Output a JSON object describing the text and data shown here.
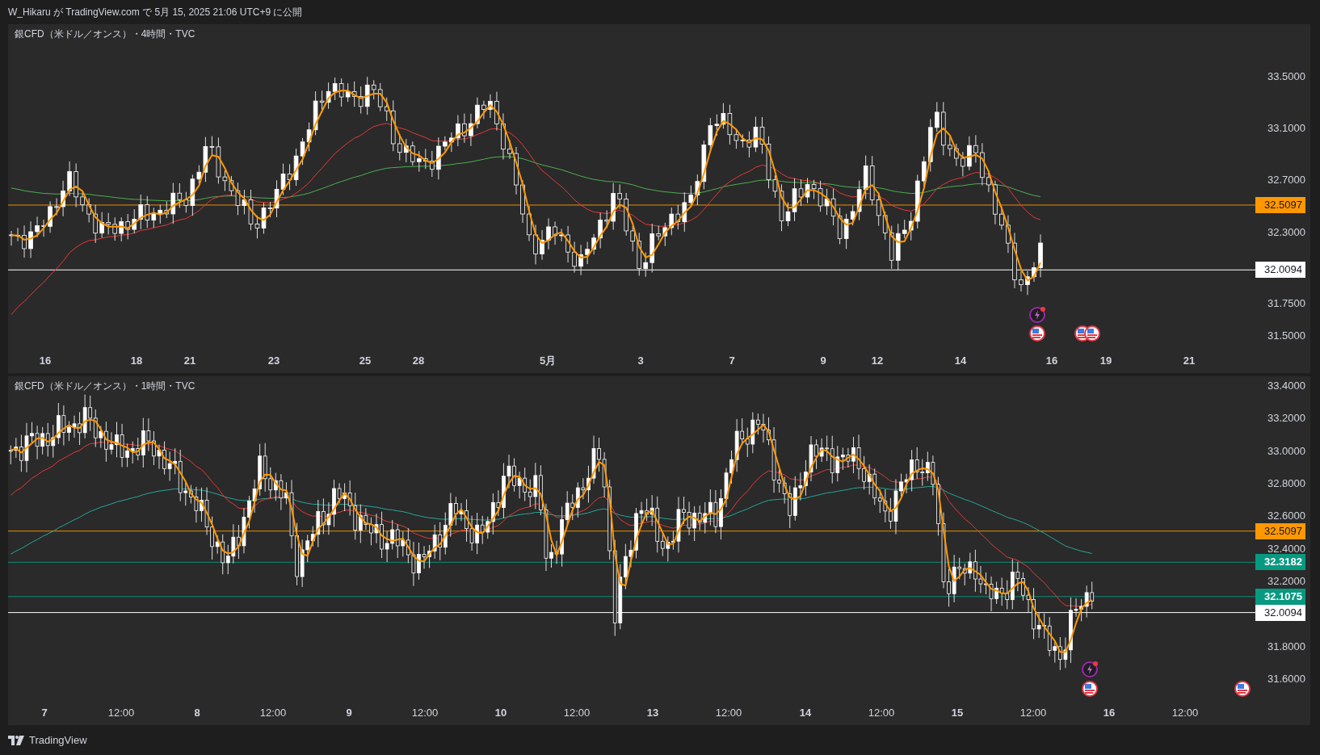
{
  "header": {
    "text": "W_Hikaru が TradingView.com で 5月 15, 2025 21:06 UTC+9 に公開"
  },
  "panels": [
    {
      "title": "銀CFD（米ドル／オンス）・4時間・TVC",
      "price_axis": [
        "33.5000",
        "33.1000",
        "32.7000",
        "32.3000",
        "31.7500",
        "31.5000"
      ],
      "levels": [
        {
          "value": "32.5097",
          "color": "#ff9800"
        },
        {
          "value": "32.0094",
          "color": "#ffffff"
        }
      ],
      "time_axis": [
        {
          "text": "16",
          "kind": "day"
        },
        {
          "text": "18",
          "kind": "day"
        },
        {
          "text": "21",
          "kind": "day"
        },
        {
          "text": "23",
          "kind": "day"
        },
        {
          "text": "25",
          "kind": "day"
        },
        {
          "text": "28",
          "kind": "day"
        },
        {
          "text": "5月",
          "kind": "month"
        },
        {
          "text": "3",
          "kind": "day"
        },
        {
          "text": "7",
          "kind": "day"
        },
        {
          "text": "9",
          "kind": "day"
        },
        {
          "text": "12",
          "kind": "day"
        },
        {
          "text": "14",
          "kind": "day"
        },
        {
          "text": "16",
          "kind": "day"
        },
        {
          "text": "19",
          "kind": "day"
        },
        {
          "text": "21",
          "kind": "day"
        }
      ]
    },
    {
      "title": "銀CFD（米ドル／オンス）・1時間・TVC",
      "price_axis": [
        "33.4000",
        "33.2000",
        "33.0000",
        "32.8000",
        "32.6000",
        "32.4000",
        "32.2000",
        "31.8000",
        "31.6000"
      ],
      "levels": [
        {
          "value": "32.5097",
          "color": "#ff9800"
        },
        {
          "value": "32.3182",
          "color": "#089981"
        },
        {
          "value": "32.1075",
          "color": "#089981"
        },
        {
          "value": "32.0094",
          "color": "#ffffff"
        }
      ],
      "time_axis": [
        {
          "text": "7",
          "kind": "day"
        },
        {
          "text": "12:00",
          "kind": "time"
        },
        {
          "text": "8",
          "kind": "day"
        },
        {
          "text": "12:00",
          "kind": "time"
        },
        {
          "text": "9",
          "kind": "day"
        },
        {
          "text": "12:00",
          "kind": "time"
        },
        {
          "text": "10",
          "kind": "day"
        },
        {
          "text": "12:00",
          "kind": "time"
        },
        {
          "text": "13",
          "kind": "day"
        },
        {
          "text": "12:00",
          "kind": "time"
        },
        {
          "text": "14",
          "kind": "day"
        },
        {
          "text": "12:00",
          "kind": "time"
        },
        {
          "text": "15",
          "kind": "day"
        },
        {
          "text": "12:00",
          "kind": "time"
        },
        {
          "text": "16",
          "kind": "day"
        },
        {
          "text": "12:00",
          "kind": "time"
        }
      ]
    }
  ],
  "footer": {
    "brand": "TradingView"
  }
}
